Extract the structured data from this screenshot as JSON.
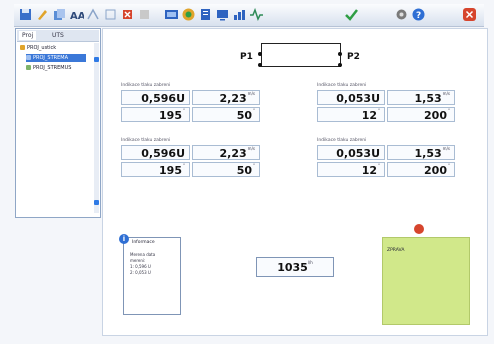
{
  "toolbar": {
    "buttons": [
      {
        "name": "save-icon",
        "color": "#3a6fc9"
      },
      {
        "name": "pencil-icon",
        "color": "#e0a42b"
      },
      {
        "name": "copy-icon",
        "color": "#5b8ed6"
      },
      {
        "name": "text-tool-icon",
        "color": "#2f4a7a"
      },
      {
        "name": "measure-icon",
        "color": "#8aa4c9"
      },
      {
        "name": "select-icon",
        "color": "#8aa4c9"
      },
      {
        "name": "delete-icon",
        "color": "#d6452d"
      },
      {
        "name": "stop-icon",
        "color": "#c9c9c9"
      },
      {
        "name": "screen-icon",
        "color": "#2e63c0"
      },
      {
        "name": "globe-icon",
        "color": "#e0a42b"
      },
      {
        "name": "document-icon",
        "color": "#2e63c0"
      },
      {
        "name": "monitor-icon",
        "color": "#2e63c0"
      },
      {
        "name": "chart-icon",
        "color": "#2e63c0"
      },
      {
        "name": "pulse-icon",
        "color": "#2e8b57"
      },
      {
        "name": "check-icon",
        "color": "#2f9e44"
      },
      {
        "name": "settings-icon",
        "color": "#7a7a7a"
      },
      {
        "name": "help-icon",
        "color": "#2f6fd4"
      },
      {
        "name": "close-icon",
        "color": "#d6452d"
      }
    ]
  },
  "sidebar": {
    "tabs": [
      "Proj",
      "UTS"
    ],
    "items": [
      {
        "label": "PROJ_ustick"
      },
      {
        "label": "PROJ_STREMA"
      },
      {
        "label": "PROJ_STREMUS"
      }
    ]
  },
  "diagram": {
    "p1_label": "P1",
    "p2_label": "P2"
  },
  "groups": [
    {
      "title": "Indikace tlaku zabreni",
      "r1": {
        "v1": "0,596",
        "u1": "U",
        "v2": "2,23",
        "u2": "m/s"
      },
      "r2": {
        "v1": "195",
        "u1": "°",
        "v2": "50",
        "u2": "°"
      }
    },
    {
      "title": "Indikace tlaku zabreni",
      "r1": {
        "v1": "0,053",
        "u1": "U",
        "v2": "1,53",
        "u2": "m/s"
      },
      "r2": {
        "v1": "12",
        "u1": "°",
        "v2": "200",
        "u2": "°"
      }
    },
    {
      "title": "Indikace tlaku zabreni",
      "r1": {
        "v1": "0,596",
        "u1": "U",
        "v2": "2,23",
        "u2": "m/s"
      },
      "r2": {
        "v1": "195",
        "u1": "°",
        "v2": "50",
        "u2": "°"
      }
    },
    {
      "title": "Indikace tlaku zabreni",
      "r1": {
        "v1": "0,053",
        "u1": "U",
        "v2": "1,53",
        "u2": "m/s"
      },
      "r2": {
        "v1": "12",
        "u1": "°",
        "v2": "200",
        "u2": "°"
      }
    }
  ],
  "info": {
    "badge": "i",
    "title": "Informace",
    "lines": [
      "Merena data",
      "mereni:",
      "1: 0,596 U",
      "2: 0,053 U"
    ]
  },
  "flow": {
    "value": "1035",
    "unit": "l/h"
  },
  "note": {
    "title": "ZPRAVA"
  }
}
